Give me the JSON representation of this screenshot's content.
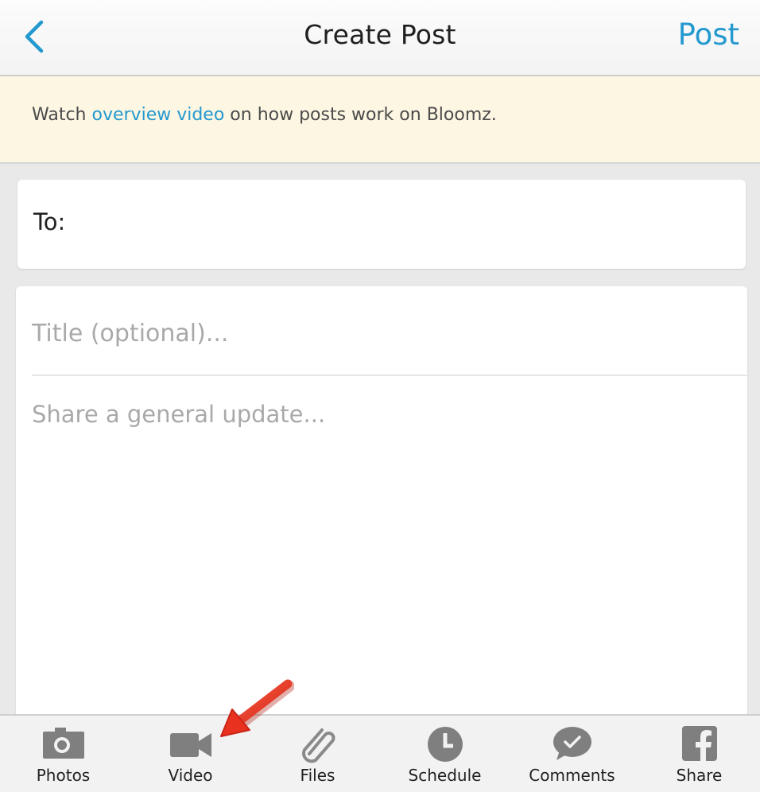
{
  "header": {
    "back_icon": "chevron-left-icon",
    "title": "Create Post",
    "post_label": "Post",
    "accent_color": "#2499cf"
  },
  "banner": {
    "prefix": "Watch ",
    "link_text": "overview video",
    "suffix": " on how posts work on Bloomz.",
    "background": "#fcf6e2"
  },
  "recipients": {
    "label": "To:",
    "value": ""
  },
  "compose": {
    "title_placeholder": "Title (optional)...",
    "body_placeholder": "Share a general update..."
  },
  "toolbar": {
    "items": [
      {
        "label": "Photos",
        "icon": "camera-icon"
      },
      {
        "label": "Video",
        "icon": "video-camera-icon"
      },
      {
        "label": "Files",
        "icon": "paperclip-icon"
      },
      {
        "label": "Schedule",
        "icon": "clock-icon"
      },
      {
        "label": "Comments",
        "icon": "comment-check-icon"
      },
      {
        "label": "Share",
        "icon": "facebook-icon"
      }
    ]
  },
  "annotation": {
    "icon": "red-arrow-icon",
    "color": "#e8321f"
  }
}
